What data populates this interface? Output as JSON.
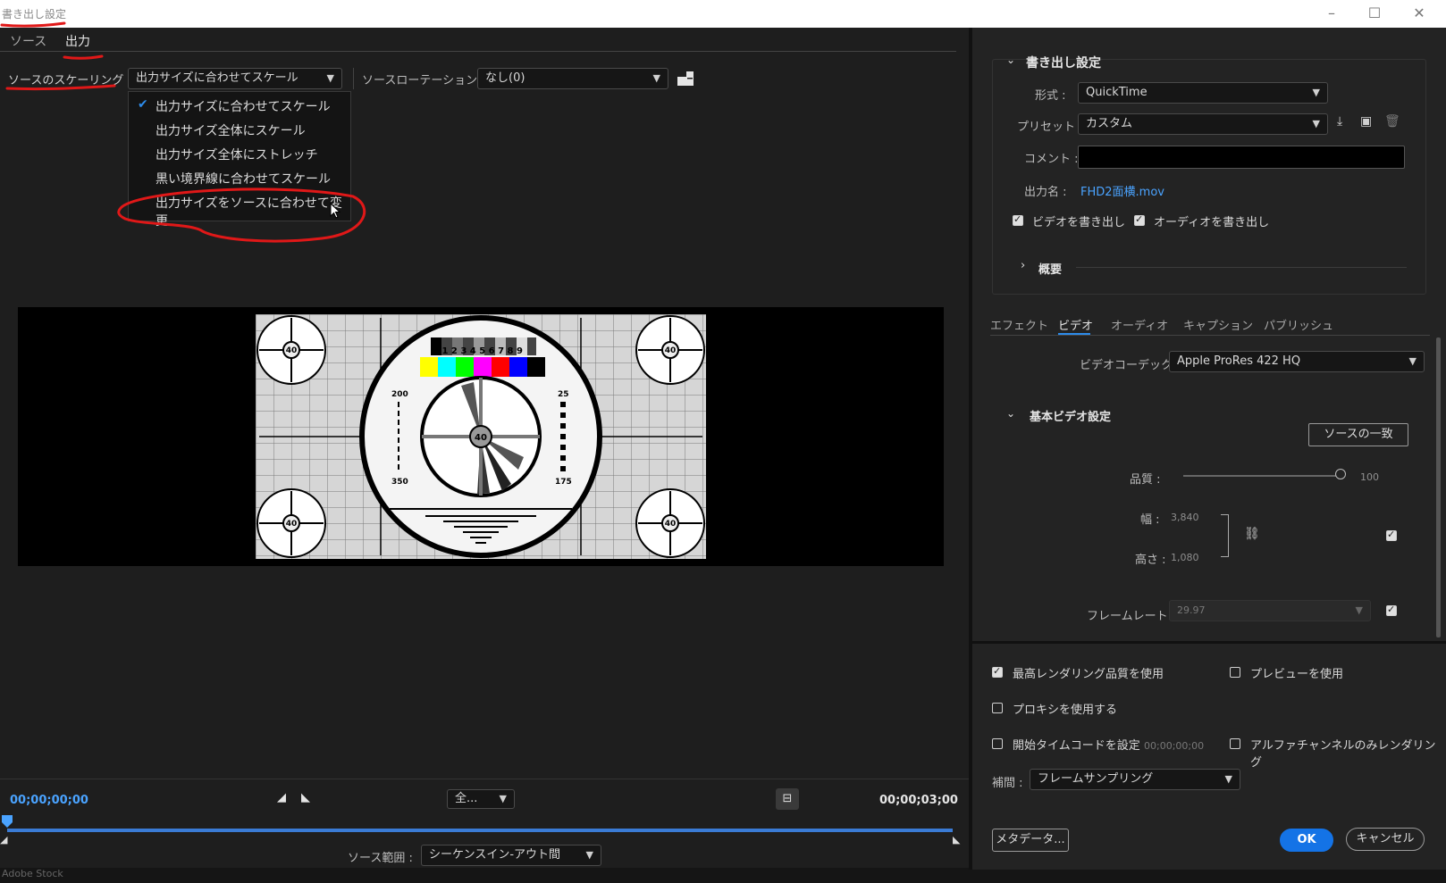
{
  "window": {
    "title": "書き出し設定"
  },
  "left": {
    "tabs": [
      {
        "label": "ソース"
      },
      {
        "label": "出力"
      }
    ],
    "scaling": {
      "label": "ソースのスケーリング :",
      "value": "出力サイズに合わせてスケール",
      "options": [
        "出力サイズに合わせてスケール",
        "出力サイズ全体にスケール",
        "出力サイズ全体にストレッチ",
        "黒い境界線に合わせてスケール",
        "出力サイズをソースに合わせて変更"
      ]
    },
    "rotation": {
      "label": "ソースローテーション :",
      "value": "なし(0)"
    },
    "testcard": {
      "sb_numbers": "0 1 2 3 4 5 6 7 8 9",
      "n40": "40",
      "n200": "200",
      "n350": "350",
      "n175": "175",
      "n25": "25"
    },
    "timeline": {
      "start": "00;00;00;00",
      "end": "00;00;03;00",
      "zoom": "全...",
      "source_range_label": "ソース範囲 :",
      "source_range_value": "シーケンスイン-アウト間",
      "playhead_fraction": 0
    },
    "footer_text": "Adobe Stock"
  },
  "right": {
    "export_settings": {
      "header": "書き出し設定",
      "format_label": "形式 :",
      "format_value": "QuickTime",
      "preset_label": "プリセット :",
      "preset_value": "カスタム",
      "comment_label": "コメント :",
      "comment_value": "",
      "output_name_label": "出力名 :",
      "output_name_value": "FHD2面横.mov",
      "export_video": "ビデオを書き出し",
      "export_audio": "オーディオを書き出し",
      "summary": "概要"
    },
    "tabs": [
      {
        "label": "エフェクト"
      },
      {
        "label": "ビデオ"
      },
      {
        "label": "オーディオ"
      },
      {
        "label": "キャプション"
      },
      {
        "label": "パブリッシュ"
      }
    ],
    "video": {
      "codec_label": "ビデオコーデック :",
      "codec_value": "Apple ProRes 422 HQ",
      "basic_header": "基本ビデオ設定",
      "match_source": "ソースの一致",
      "quality_label": "品質 :",
      "quality_value": "100",
      "quality_fraction": 1.0,
      "width_label": "幅 :",
      "width_value": "3,840",
      "height_label": "高さ :",
      "height_value": "1,080",
      "framerate_label": "フレームレート :",
      "framerate_value": "29.97"
    },
    "options": {
      "max_quality": "最高レンダリング品質を使用",
      "use_preview": "プレビューを使用",
      "use_proxy": "プロキシを使用する",
      "set_start_tc": "開始タイムコードを設定",
      "start_tc_value": "00;00;00;00",
      "alpha_only": "アルファチャンネルのみレンダリング",
      "interp_label": "補間 :",
      "interp_value": "フレームサンプリング"
    },
    "buttons": {
      "metadata": "メタデータ...",
      "ok": "OK",
      "cancel": "キャンセル"
    }
  },
  "colors": {
    "accent": "#2d8ceb",
    "annotation": "#e01818",
    "ok": "#1473e6"
  }
}
